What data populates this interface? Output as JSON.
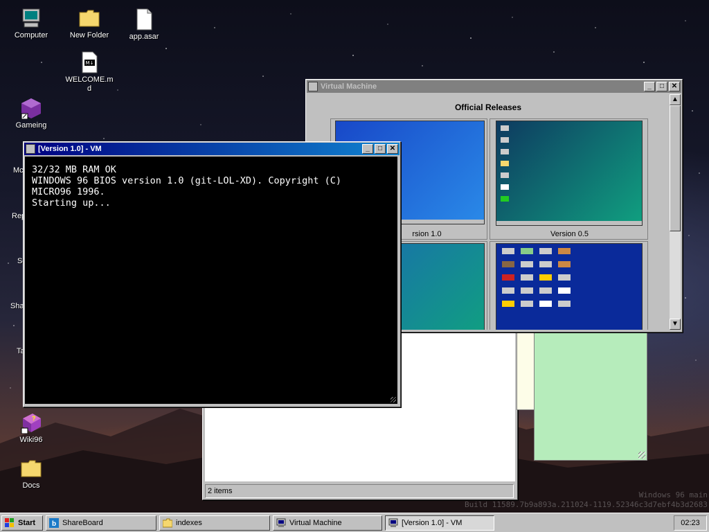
{
  "desktop": {
    "icons": [
      {
        "label": "Computer",
        "icon": "computer-icon"
      },
      {
        "label": "New Folder",
        "icon": "folder-icon"
      },
      {
        "label": "app.asar",
        "icon": "file-icon"
      },
      {
        "label": "WELCOME.md",
        "icon": "markdown-file-icon"
      },
      {
        "label": "Gameing",
        "icon": "game-cube-icon"
      },
      {
        "label": "Wiki96",
        "icon": "wiki-book-icon"
      },
      {
        "label": "Docs",
        "icon": "folder-icon"
      }
    ],
    "partial_labels": [
      "Mc M",
      "Rep",
      "So",
      "Sha",
      "Ta"
    ],
    "watermark": {
      "line1": "Windows 96 main",
      "line2": "Build 11589.7b9a893a.211024-1119.52346c3d7ebf4b3d2683"
    }
  },
  "vm_window": {
    "title": "Virtual Machine",
    "heading": "Official Releases",
    "releases": [
      {
        "label": "Version 1.0"
      },
      {
        "label": "Version 0.5"
      },
      {
        "label": ""
      },
      {
        "label": ""
      }
    ],
    "thumbnail_caption_visible": "rsion 1.0"
  },
  "console_window": {
    "title": "[Version 1.0] - VM",
    "lines": [
      "32/32 MB RAM OK",
      "WINDOWS 96 BIOS version 1.0 (git-LOL-XD). Copyright (C)",
      "MICRO96 1996.",
      "Starting up..."
    ]
  },
  "explorer_window": {
    "status": "2 items"
  },
  "taskbar": {
    "start_label": "Start",
    "items": [
      {
        "label": "ShareBoard",
        "icon": "shareboard-icon"
      },
      {
        "label": "indexes",
        "icon": "folder-icon"
      },
      {
        "label": "Virtual Machine",
        "icon": "vm-icon"
      },
      {
        "label": "[Version 1.0] - VM",
        "icon": "vm-icon"
      }
    ],
    "clock": "02:23"
  },
  "colors": {
    "title_active": "#000080",
    "window_face": "#c0c0c0",
    "console_bg": "#000000",
    "console_fg": "#ffffff",
    "green_pane": "#b6ecbb"
  }
}
